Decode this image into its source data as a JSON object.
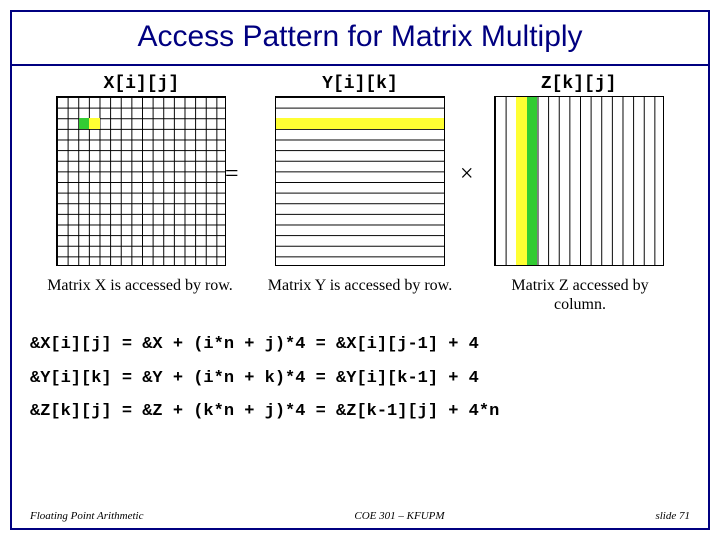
{
  "title": "Access Pattern for Matrix Multiply",
  "labels": {
    "x": "X[i][j]",
    "y": "Y[i][k]",
    "z": "Z[k][j]"
  },
  "ops": {
    "eq": "=",
    "times": "×"
  },
  "captions": {
    "x": "Matrix X is accessed by row.",
    "y": "Matrix Y is accessed by row.",
    "z": "Matrix Z accessed by column."
  },
  "formulas": {
    "f1": "&X[i][j] = &X + (i*n + j)*4 = &X[i][j-1] + 4",
    "f2": "&Y[i][k] = &Y + (i*n + k)*4 = &Y[i][k-1] + 4",
    "f3": "&Z[k][j] = &Z + (k*n + j)*4 = &Z[k-1][j] + 4*n"
  },
  "footer": {
    "left": "Floating Point Arithmetic",
    "mid": "COE 301 – KFUPM",
    "right": "slide 71"
  }
}
